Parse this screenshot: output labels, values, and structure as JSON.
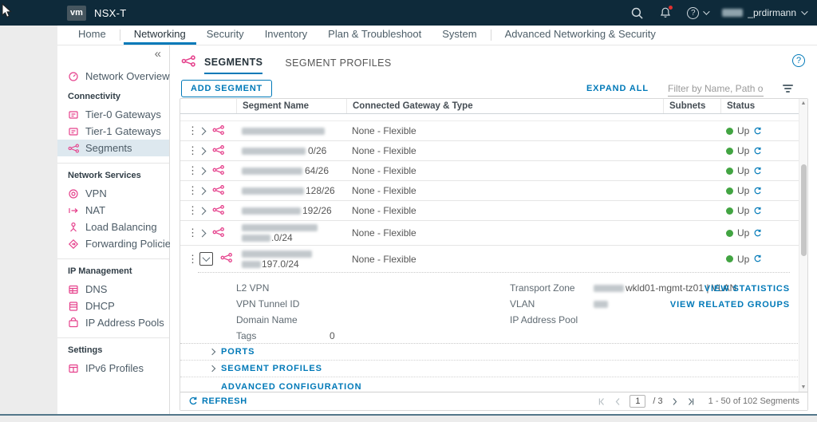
{
  "colors": {
    "accent_blue": "#0079b8",
    "brand_pink": "#e5418c",
    "status_green": "#42a442",
    "topbar_bg": "#0e2a3a"
  },
  "topbar": {
    "logo": "vm",
    "title": "NSX-T",
    "user_visible": "_prdirmann"
  },
  "nav": {
    "tabs": [
      "Home",
      "Networking",
      "Security",
      "Inventory",
      "Plan & Troubleshoot",
      "System",
      "Advanced Networking & Security"
    ],
    "active": "Networking"
  },
  "sidebar": {
    "collapse_glyph": "«",
    "sections": [
      {
        "header": "",
        "items": [
          {
            "label": "Network Overview"
          }
        ]
      },
      {
        "header": "Connectivity",
        "items": [
          {
            "label": "Tier-0 Gateways"
          },
          {
            "label": "Tier-1 Gateways"
          },
          {
            "label": "Segments"
          }
        ]
      },
      {
        "header": "Network Services",
        "items": [
          {
            "label": "VPN"
          },
          {
            "label": "NAT"
          },
          {
            "label": "Load Balancing"
          },
          {
            "label": "Forwarding Policies"
          }
        ]
      },
      {
        "header": "IP Management",
        "items": [
          {
            "label": "DNS"
          },
          {
            "label": "DHCP"
          },
          {
            "label": "IP Address Pools"
          }
        ]
      },
      {
        "header": "Settings",
        "items": [
          {
            "label": "IPv6 Profiles"
          }
        ]
      }
    ]
  },
  "content": {
    "tabs": [
      "SEGMENTS",
      "SEGMENT PROFILES"
    ],
    "help_glyph": "?",
    "toolbar": {
      "add": "ADD SEGMENT",
      "expand_all": "EXPAND ALL",
      "filter_placeholder": "Filter by Name, Path or more"
    },
    "table": {
      "columns": [
        "Segment Name",
        "Connected Gateway & Type",
        "Subnets",
        "Status"
      ],
      "rows": [
        {
          "name_visible": "",
          "gateway": "None - Flexible",
          "subnets": "",
          "status": "Up"
        },
        {
          "name_visible": "0/26",
          "gateway": "None - Flexible",
          "subnets": "",
          "status": "Up"
        },
        {
          "name_visible": "64/26",
          "gateway": "None - Flexible",
          "subnets": "",
          "status": "Up"
        },
        {
          "name_visible": "128/26",
          "gateway": "None - Flexible",
          "subnets": "",
          "status": "Up"
        },
        {
          "name_visible": "192/26",
          "gateway": "None - Flexible",
          "subnets": "",
          "status": "Up"
        },
        {
          "name_line2_visible": ".0/24",
          "gateway": "None - Flexible",
          "subnets": "",
          "status": "Up"
        },
        {
          "name_line2_visible": "197.0/24",
          "gateway": "None - Flexible",
          "subnets": "",
          "status": "Up"
        }
      ]
    },
    "detail": {
      "l2vpn_label": "L2 VPN",
      "vpn_tunnel_label": "VPN Tunnel ID",
      "domain_label": "Domain Name",
      "tags_label": "Tags",
      "tags_value": "0",
      "tz_label": "Transport Zone",
      "tz_value_visible": "wkld01-mgmt-tz01 | VLAN",
      "vlan_label": "VLAN",
      "pool_label": "IP Address Pool",
      "link_statistics": "VIEW STATISTICS",
      "link_related": "VIEW RELATED GROUPS",
      "ports_label": "PORTS",
      "segment_profiles_label": "SEGMENT PROFILES",
      "advanced_label": "ADVANCED CONFIGURATION"
    },
    "footer": {
      "refresh": "REFRESH",
      "page": "1",
      "of_pages": "/ 3",
      "range": "1 - 50 of 102 Segments"
    }
  }
}
